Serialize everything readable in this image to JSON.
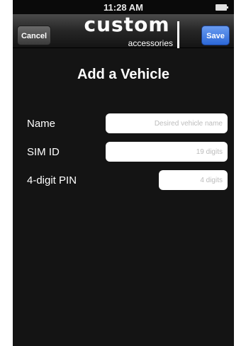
{
  "status_bar": {
    "time": "11:28 AM"
  },
  "nav_bar": {
    "cancel_label": "Cancel",
    "save_label": "Save",
    "logo_word": "custom",
    "logo_sub": "accessories"
  },
  "page": {
    "title": "Add a Vehicle"
  },
  "form": {
    "fields": [
      {
        "label": "Name",
        "value": "",
        "placeholder": "Desired vehicle name"
      },
      {
        "label": "SIM ID",
        "value": "",
        "placeholder": "19 digits"
      },
      {
        "label": "4-digit PIN",
        "value": "",
        "placeholder": "4 digits"
      }
    ]
  },
  "colors": {
    "background": "#141414",
    "save_button": "#2c68d8",
    "cancel_button": "#4a4a4a",
    "text": "#ffffff"
  }
}
